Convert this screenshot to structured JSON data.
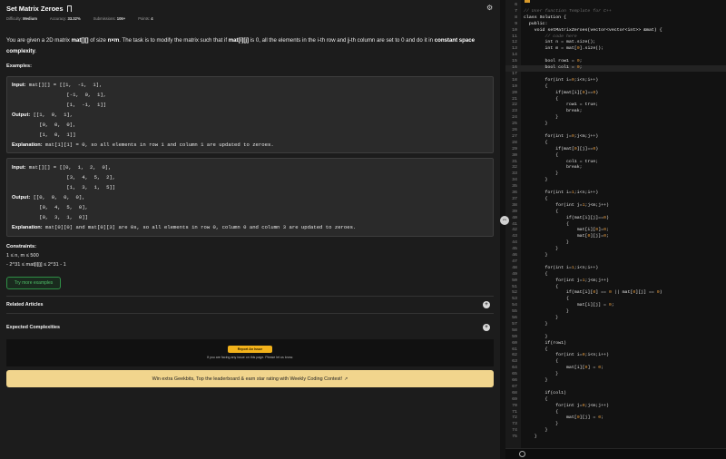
{
  "problem": {
    "title": "Set Matrix Zeroes",
    "meta": [
      {
        "label": "Difficulty:",
        "value": "Medium"
      },
      {
        "label": "Accuracy:",
        "value": "33.32%"
      },
      {
        "label": "Submissions:",
        "value": "106+"
      },
      {
        "label": "Points:",
        "value": "4"
      }
    ],
    "description": {
      "p1": "You are given a 2D matrix ",
      "b1": "mat[][]",
      "p2": " of size ",
      "b2": "n×m",
      "p3": ". The task is to modify the matrix such that if ",
      "b3": "mat[i][j]",
      "p4": " is 0, all the elements in the i-th row and ",
      "b4": "j",
      "p5": "-th column are set to 0 and do it in ",
      "b5": "constant space complexity",
      "p6": "."
    },
    "examples_label": "Examples:",
    "examples": [
      {
        "input_label": "Input:",
        "input_lines": [
          "mat[][] = [[1,  -1,  1],",
          "           [-1,  0,  1],",
          "           [1,  -1,  1]]"
        ],
        "output_label": "Output:",
        "output_lines": [
          "[[1,  0,  1],",
          " [0,  0,  0],",
          " [1,  0,  1]]"
        ],
        "explanation_label": "Explanation:",
        "explanation": "mat[1][1] = 0, so all elements in row 1 and column 1 are updated to zeroes."
      },
      {
        "input_label": "Input:",
        "input_lines": [
          "mat[][] = [[0,  1,  2,  0],",
          "           [3,  4,  5,  2],",
          "           [1,  3,  1,  5]]"
        ],
        "output_label": "Output:",
        "output_lines": [
          "[[0,  0,  0,  0],",
          " [0,  4,  5,  0],",
          " [0,  3,  1,  0]]"
        ],
        "explanation_label": "Explanation:",
        "explanation": "mat[0][0] and mat[0][3] are 0s, so all elements in row 0, column 0 and column 3 are updated to zeroes."
      }
    ],
    "constraints_label": "Constraints:",
    "constraints": [
      "1 ≤ n, m ≤ 500",
      "- 2^31 ≤ mat[i][j] ≤ 2^31 - 1"
    ],
    "try_more": "Try more examples",
    "accordions": [
      "Related Articles",
      "Expected Complexities"
    ],
    "report": {
      "button": "Report An Issue",
      "note": "If you are facing any issue on this page. Please let us know."
    },
    "contest_banner": "Win extra Geekbits, Top the leaderboard & earn star rating with Weekly Coding Contest!"
  },
  "editor": {
    "lines": [
      {
        "n": "6",
        "t": "",
        "c": "pl"
      },
      {
        "n": "7",
        "t": "// User function Template for C++",
        "c": "cmt"
      },
      {
        "n": "8",
        "t": "class Solution {",
        "c": "kw"
      },
      {
        "n": "9",
        "t": "  public:",
        "c": "kw"
      },
      {
        "n": "10",
        "t": "    void setMatrixZeroes(vector<vector<int>> &mat) {",
        "c": "kw"
      },
      {
        "n": "11",
        "t": "        // code here",
        "c": "cmt"
      },
      {
        "n": "12",
        "t": "        int n = mat.size();",
        "c": "pl"
      },
      {
        "n": "13",
        "t": "        int m = mat[0].size();",
        "c": "pl"
      },
      {
        "n": "14",
        "t": "",
        "c": "pl"
      },
      {
        "n": "15",
        "t": "        bool row1 = 0;",
        "c": "pl"
      },
      {
        "n": "16",
        "t": "        bool col1 = 0;",
        "c": "pl"
      },
      {
        "n": "17",
        "t": "",
        "c": "pl"
      },
      {
        "n": "18",
        "t": "        for(int i=0;i<n;i++)",
        "c": "pl"
      },
      {
        "n": "19",
        "t": "        {",
        "c": "pl"
      },
      {
        "n": "20",
        "t": "            if(mat[i][0]==0)",
        "c": "pl"
      },
      {
        "n": "21",
        "t": "            {",
        "c": "pl"
      },
      {
        "n": "22",
        "t": "                row1 = true;",
        "c": "pl"
      },
      {
        "n": "23",
        "t": "                break;",
        "c": "pl"
      },
      {
        "n": "24",
        "t": "            }",
        "c": "pl"
      },
      {
        "n": "25",
        "t": "        }",
        "c": "pl"
      },
      {
        "n": "26",
        "t": "",
        "c": "pl"
      },
      {
        "n": "27",
        "t": "        for(int j=0;j<m;j++)",
        "c": "pl"
      },
      {
        "n": "28",
        "t": "        {",
        "c": "pl"
      },
      {
        "n": "29",
        "t": "            if(mat[0][j]==0)",
        "c": "pl"
      },
      {
        "n": "30",
        "t": "            {",
        "c": "pl"
      },
      {
        "n": "31",
        "t": "                col1 = true;",
        "c": "pl"
      },
      {
        "n": "32",
        "t": "                break;",
        "c": "pl"
      },
      {
        "n": "33",
        "t": "            }",
        "c": "pl"
      },
      {
        "n": "34",
        "t": "        }",
        "c": "pl"
      },
      {
        "n": "35",
        "t": "",
        "c": "pl"
      },
      {
        "n": "36",
        "t": "        for(int i=1;i<n;i++)",
        "c": "pl"
      },
      {
        "n": "37",
        "t": "        {",
        "c": "pl"
      },
      {
        "n": "38",
        "t": "            for(int j=1;j<m;j++)",
        "c": "pl"
      },
      {
        "n": "39",
        "t": "            {",
        "c": "pl"
      },
      {
        "n": "40",
        "t": "                if(mat[i][j]==0)",
        "c": "pl"
      },
      {
        "n": "41",
        "t": "                {",
        "c": "pl"
      },
      {
        "n": "42",
        "t": "                    mat[i][0]=0;",
        "c": "pl"
      },
      {
        "n": "43",
        "t": "                    mat[0][j]=0;",
        "c": "pl"
      },
      {
        "n": "44",
        "t": "                }",
        "c": "pl"
      },
      {
        "n": "45",
        "t": "            }",
        "c": "pl"
      },
      {
        "n": "46",
        "t": "        }",
        "c": "pl"
      },
      {
        "n": "47",
        "t": "",
        "c": "pl"
      },
      {
        "n": "48",
        "t": "        for(int i=1;i<n;i++)",
        "c": "pl"
      },
      {
        "n": "49",
        "t": "        {",
        "c": "pl"
      },
      {
        "n": "50",
        "t": "            for(int j=1;j<m;j++)",
        "c": "pl"
      },
      {
        "n": "51",
        "t": "            {",
        "c": "pl"
      },
      {
        "n": "52",
        "t": "                if(mat[i][0] == 0 || mat[0][j] == 0)",
        "c": "pl"
      },
      {
        "n": "53",
        "t": "                {",
        "c": "pl"
      },
      {
        "n": "54",
        "t": "                    mat[i][j] = 0;",
        "c": "pl"
      },
      {
        "n": "55",
        "t": "                }",
        "c": "pl"
      },
      {
        "n": "56",
        "t": "            }",
        "c": "pl"
      },
      {
        "n": "57",
        "t": "        }",
        "c": "pl"
      },
      {
        "n": "58",
        "t": "",
        "c": "pl"
      },
      {
        "n": "59",
        "t": "        }",
        "c": "pl"
      },
      {
        "n": "60",
        "t": "        if(row1)",
        "c": "pl"
      },
      {
        "n": "61",
        "t": "        {",
        "c": "pl"
      },
      {
        "n": "62",
        "t": "            for(int i=0;i<n;i++)",
        "c": "pl"
      },
      {
        "n": "63",
        "t": "            {",
        "c": "pl"
      },
      {
        "n": "64",
        "t": "                mat[i][0] = 0;",
        "c": "pl"
      },
      {
        "n": "65",
        "t": "            }",
        "c": "pl"
      },
      {
        "n": "66",
        "t": "        }",
        "c": "pl"
      },
      {
        "n": "67",
        "t": "",
        "c": "pl"
      },
      {
        "n": "68",
        "t": "        if(col1)",
        "c": "pl"
      },
      {
        "n": "69",
        "t": "        {",
        "c": "pl"
      },
      {
        "n": "70",
        "t": "            for(int j=0;j<m;j++)",
        "c": "pl"
      },
      {
        "n": "71",
        "t": "            {",
        "c": "pl"
      },
      {
        "n": "72",
        "t": "                mat[0][j] = 0;",
        "c": "pl"
      },
      {
        "n": "73",
        "t": "            }",
        "c": "pl"
      },
      {
        "n": "74",
        "t": "        }",
        "c": "pl"
      },
      {
        "n": "75",
        "t": "    }",
        "c": "pl"
      }
    ],
    "highlight_line": "16"
  },
  "icons": {
    "gear": "gear-icon",
    "bookmark": "bookmark-icon",
    "drag": "drag-handle-icon",
    "expand": "expand-icon"
  },
  "colors": {
    "accent_green": "#2f8f46",
    "report_yellow": "#f2b21b",
    "banner": "#f1d58d"
  }
}
